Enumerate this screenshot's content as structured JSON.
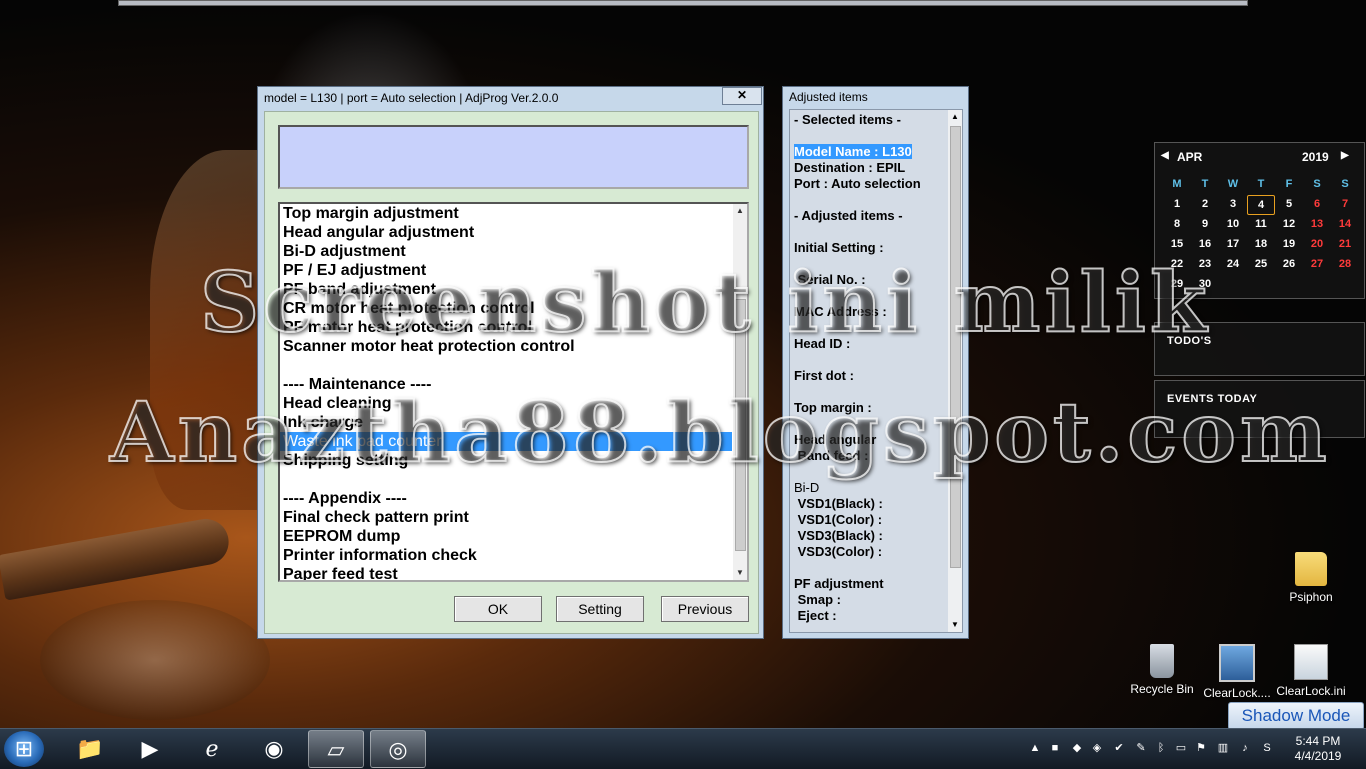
{
  "dialog": {
    "title": "model = L130 | port = Auto selection | AdjProg Ver.2.0.0",
    "close_glyph": "✕",
    "description": "",
    "list_items": [
      "Top margin adjustment",
      "Head angular adjustment",
      "Bi-D adjustment",
      "PF / EJ adjustment",
      "PF band adjustment",
      "CR motor heat protection control",
      "PF motor heat protection control",
      "Scanner motor heat protection control",
      "",
      "---- Maintenance ----",
      "Head cleaning",
      "Ink charge",
      "Waste ink pad counter",
      "Shipping setting",
      "",
      "---- Appendix ----",
      "Final check pattern print",
      "EEPROM dump",
      "Printer information check",
      "Paper feed test"
    ],
    "selected_index": 12,
    "buttons": {
      "ok": "OK",
      "setting": "Setting",
      "previous": "Previous"
    }
  },
  "adjusted": {
    "title": "Adjusted items",
    "lines": [
      "- Selected items -",
      "",
      "Model Name : L130",
      "Destination : EPIL",
      "Port : Auto selection",
      "",
      "- Adjusted items -",
      "",
      "Initial Setting :",
      "",
      " Serial No. :",
      "",
      "MAC Address :",
      "",
      "Head ID :",
      "",
      "First dot :",
      "",
      "Top margin :",
      "",
      "Head angular",
      " Band feed :",
      "",
      "Bi-D",
      " VSD1(Black) :",
      " VSD1(Color) :",
      " VSD3(Black) :",
      " VSD3(Color) :",
      "",
      "PF adjustment",
      " Smap :",
      " Eject :"
    ],
    "highlight_index": 2,
    "normal_weight_index": 23
  },
  "calendar": {
    "month": "APR",
    "year": "2019",
    "weekdays": [
      "M",
      "T",
      "W",
      "T",
      "F",
      "S",
      "S"
    ],
    "weeks": [
      [
        "1",
        "2",
        "3",
        "4",
        "5",
        "6",
        "7"
      ],
      [
        "8",
        "9",
        "10",
        "11",
        "12",
        "13",
        "14"
      ],
      [
        "15",
        "16",
        "17",
        "18",
        "19",
        "20",
        "21"
      ],
      [
        "22",
        "23",
        "24",
        "25",
        "26",
        "27",
        "28"
      ],
      [
        "29",
        "30",
        "",
        "",
        "",
        "",
        ""
      ]
    ],
    "today": "4"
  },
  "gadgets": {
    "todos": "TODO'S",
    "events": "EVENTS TODAY"
  },
  "desktop_icons": {
    "psiphon": "Psiphon",
    "recycle_bin": "Recycle Bin",
    "clearlock": "ClearLock....",
    "clearlock_ini": "ClearLock.ini"
  },
  "shadow_mode": "Shadow Mode",
  "watermark": {
    "line1": "Screenshot ini milik",
    "line2": "Anaztha88.blogspot.com"
  },
  "taskbar": {
    "time": "5:44 PM",
    "date": "4/4/2019",
    "pinned": [
      "explorer-icon",
      "media-player-icon",
      "internet-explorer-icon",
      "firefox-icon",
      "adjprog-icon",
      "app-icon"
    ]
  },
  "colors": {
    "selection": "#3399ff",
    "dialog_bg": "#d7ead3",
    "description_bg": "#c8d1fb",
    "weekend": "#ff3b3b",
    "weekday_header": "#5fc0e8"
  }
}
